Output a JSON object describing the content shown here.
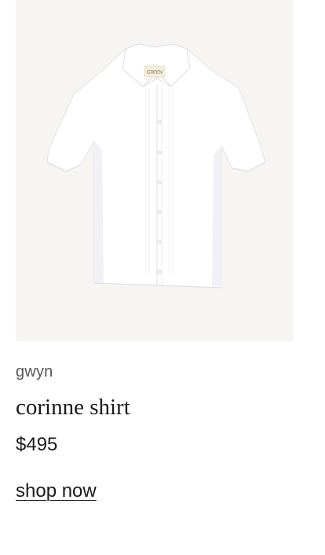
{
  "product": {
    "brand": "gwyn",
    "name": "corinne shirt",
    "price": "$495",
    "cta_label": "shop now",
    "image_label_text": "GWYN",
    "image_background": "#f6f5f2",
    "shirt_color": "#ffffff"
  }
}
